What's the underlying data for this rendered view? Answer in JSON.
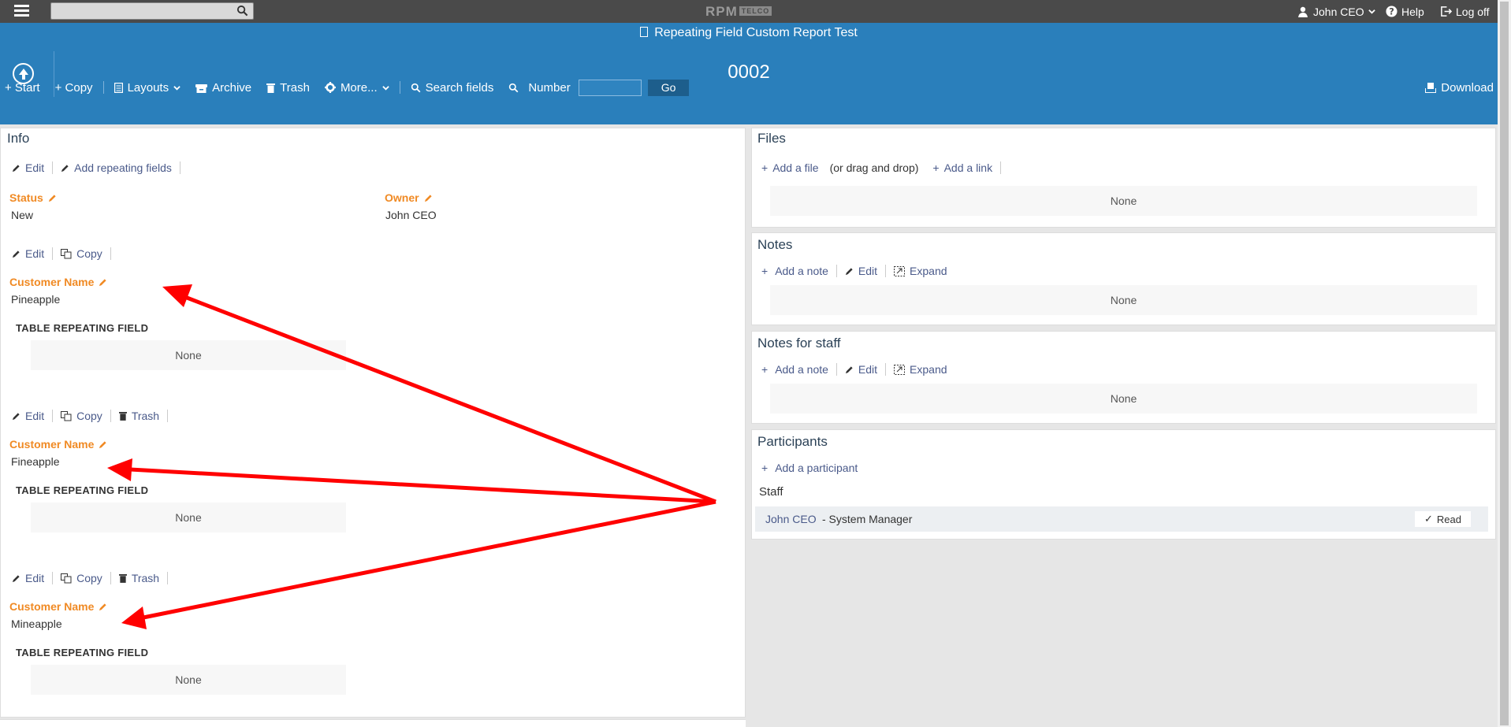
{
  "topbar": {
    "search_placeholder": "",
    "logo_text": "RPM",
    "logo_suffix": "TELCO",
    "user_name": "John CEO",
    "help_label": "Help",
    "logoff_label": "Log off"
  },
  "header": {
    "report_title": "Repeating Field Custom Report Test",
    "record_number": "0002"
  },
  "toolbar": {
    "start": "+ Start",
    "copy": "+ Copy",
    "layouts": "Layouts",
    "archive": "Archive",
    "trash": "Trash",
    "more": "More...",
    "search_fields": "Search fields",
    "number_label": "Number",
    "number_value": "",
    "go": "Go",
    "download": "Download"
  },
  "info": {
    "title": "Info",
    "edit": "Edit",
    "add_repeating": "Add repeating fields",
    "status_label": "Status",
    "status_value": "New",
    "owner_label": "Owner",
    "owner_value": "John CEO",
    "repeating_groups": [
      {
        "edit": "Edit",
        "copy": "Copy",
        "trash": "",
        "field_label": "Customer Name",
        "field_value": "Pineapple",
        "table_label": "TABLE REPEATING FIELD",
        "table_value": "None"
      },
      {
        "edit": "Edit",
        "copy": "Copy",
        "trash": "Trash",
        "field_label": "Customer Name",
        "field_value": "Fineapple",
        "table_label": "TABLE REPEATING FIELD",
        "table_value": "None"
      },
      {
        "edit": "Edit",
        "copy": "Copy",
        "trash": "Trash",
        "field_label": "Customer Name",
        "field_value": "Mineapple",
        "table_label": "TABLE REPEATING FIELD",
        "table_value": "None"
      }
    ]
  },
  "files": {
    "title": "Files",
    "add_file": "Add a file",
    "drag_hint": "(or drag and drop)",
    "add_link": "Add a link",
    "empty": "None"
  },
  "notes": {
    "title": "Notes",
    "add_note": "Add a note",
    "edit": "Edit",
    "expand": "Expand",
    "empty": "None"
  },
  "staff_notes": {
    "title": "Notes for staff",
    "add_note": "Add a note",
    "edit": "Edit",
    "expand": "Expand",
    "empty": "None"
  },
  "participants": {
    "title": "Participants",
    "add": "Add a participant",
    "staff_heading": "Staff",
    "staff_name": "John CEO",
    "staff_role": "- System Manager",
    "read_label": "Read"
  },
  "colors": {
    "header_blue": "#2a7fbb",
    "field_label_orange": "#f08a24",
    "annotation_red": "#ff0000"
  }
}
